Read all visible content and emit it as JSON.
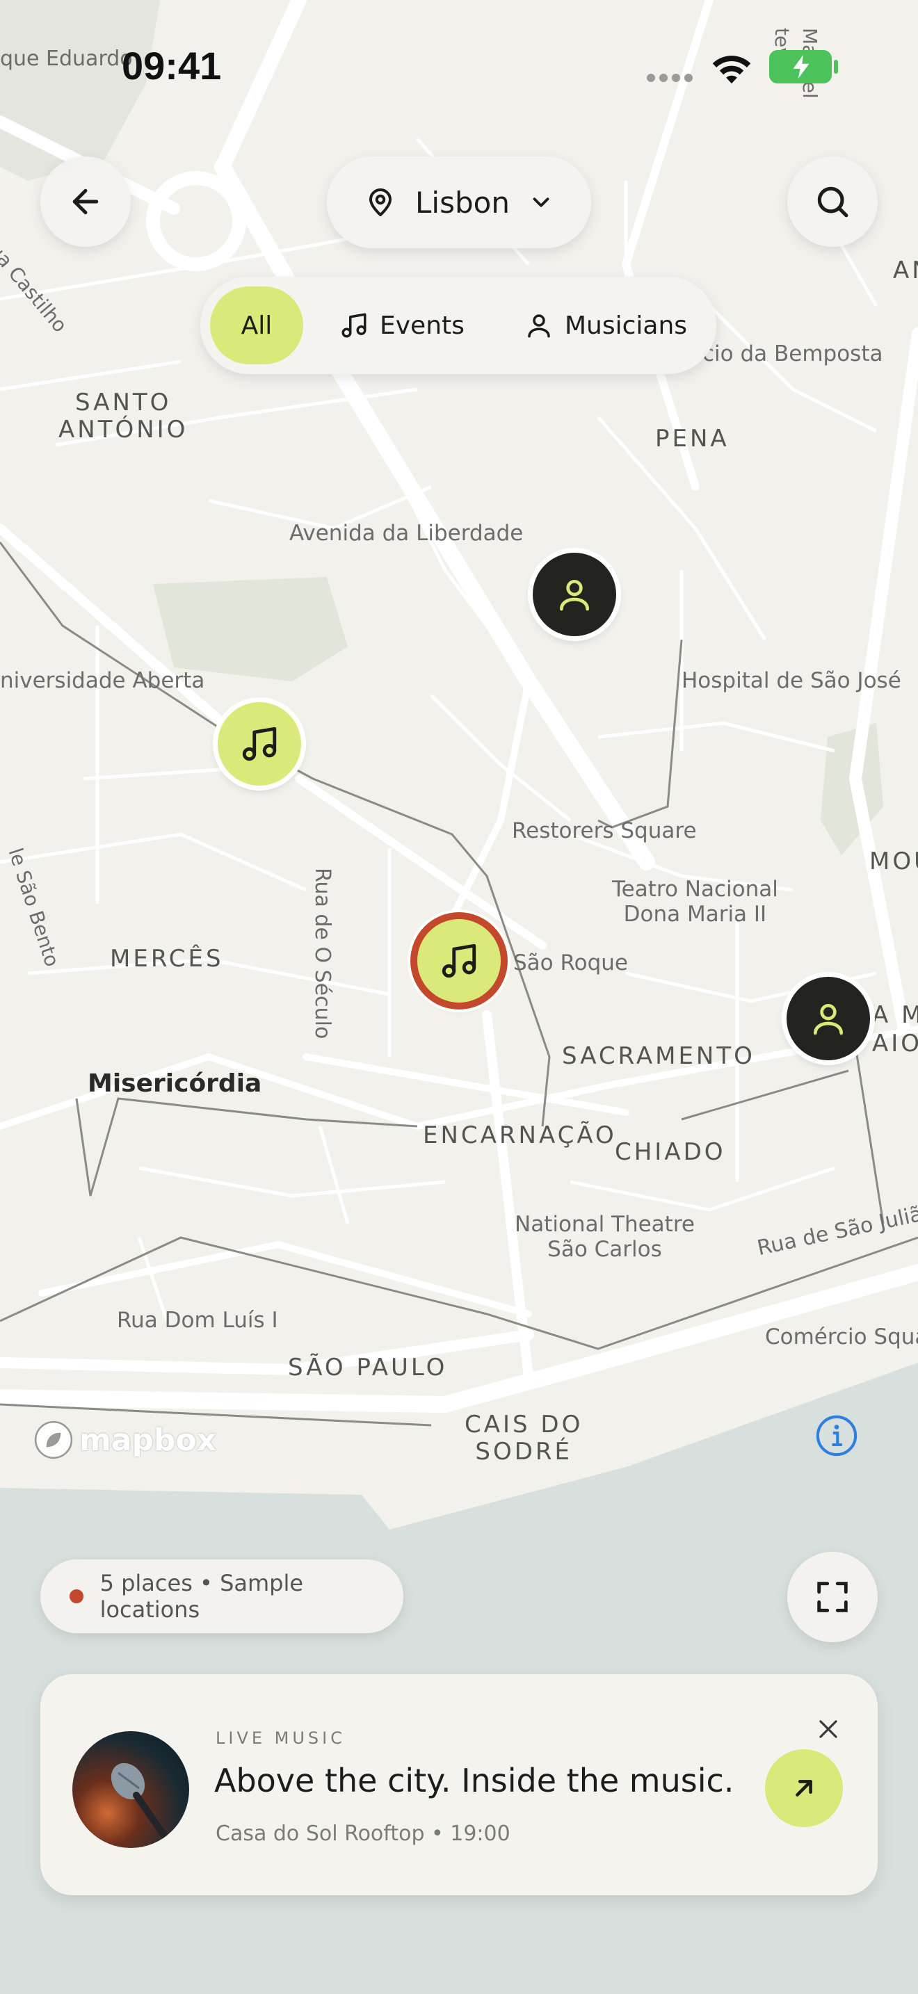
{
  "status_bar": {
    "time": "09:41"
  },
  "header": {
    "location": "Lisbon"
  },
  "filters": [
    {
      "label": "All",
      "selected": true
    },
    {
      "label": "Events",
      "selected": false
    },
    {
      "label": "Musicians",
      "selected": false
    }
  ],
  "map_labels": {
    "santo_antonio": "SANTO\nANTÓNIO",
    "pena": "PENA",
    "avenida": "Avenida da Liberdade",
    "palacio": "cio da Bemposta",
    "hospital": "Hospital de São José",
    "universidade": "niversidade Aberta",
    "restorers": "Restorers Square",
    "teatro": "Teatro Nacional\nDona Maria II",
    "sao_roque": "São Roque",
    "merces": "MERCÊS",
    "rua_seculo": "Rua de O Século",
    "sao_bento": "le São Bento",
    "misericordia": "Misericórdia",
    "sacramento": "SACRAMENTO",
    "encarnacao": "ENCARNAÇÃO",
    "chiado": "CHIADO",
    "national_theatre": "National Theatre\nSão Carlos",
    "rua_sao_juliao": "Rua de São Julião",
    "rua_dom_luis": "Rua Dom Luís I",
    "sao_paulo": "SÃO PAULO",
    "cais_sodre": "CAIS DO\nSODRÉ",
    "comercio": "Comércio Squa",
    "eduardo": "que Eduardo",
    "castilho": "Rua Castilho",
    "an": "AN",
    "mou": "MOU",
    "a_m": "A M\nAIO",
    "manuel": "Manuel",
    "estevao": "tevão"
  },
  "attribution": {
    "brand": "mapbox"
  },
  "summary": {
    "text": "5 places • Sample locations"
  },
  "card": {
    "tag": "LIVE MUSIC",
    "title": "Above the city. Inside the music.",
    "subtitle": "Casa do Sol Rooftop • 19:00"
  },
  "colors": {
    "accent": "#dbe97a",
    "marker_dark": "#23231f",
    "selected_ring": "#c4492c",
    "water": "#d8e0de",
    "land": "#f2f1ec"
  }
}
